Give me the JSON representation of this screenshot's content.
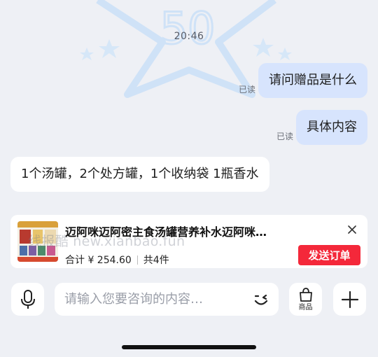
{
  "header": {
    "time": "20:46",
    "badge_number": "50"
  },
  "messages": [
    {
      "text": "请问赠品是什么",
      "direction": "outgoing",
      "status": "已读"
    },
    {
      "text": "具体内容",
      "direction": "outgoing",
      "status": "已读"
    },
    {
      "text": "1个汤罐，2个处方罐，1个收纳袋 1瓶香水",
      "direction": "incoming"
    }
  ],
  "product": {
    "title": "迈阿咪迈阿密主食汤罐营养补水迈阿咪…",
    "total_label": "合计 ¥ 254.60",
    "count_label": "共4件",
    "send_button": "发送订单",
    "close_icon": "close-icon"
  },
  "watermark": "线报酷 new.xianbao.fun",
  "input": {
    "placeholder": "请输入您要咨询的内容…",
    "goods_label": "商品"
  },
  "colors": {
    "accent_red": "#f4283a",
    "outgoing_bubble": "#d7e4fd",
    "background": "#eef0f5"
  }
}
